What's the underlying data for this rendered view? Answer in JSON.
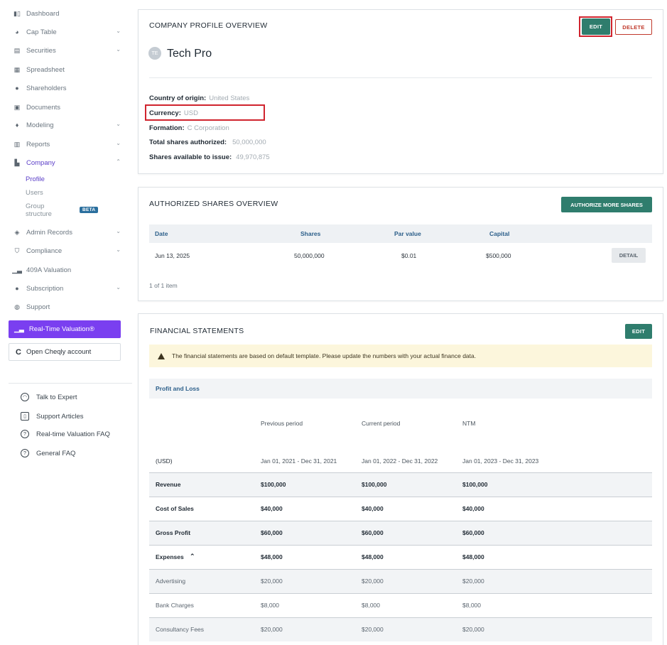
{
  "sidebar": {
    "items": [
      {
        "label": "Dashboard",
        "icon": "dashboard-icon"
      },
      {
        "label": "Cap Table",
        "icon": "pie-chart-icon"
      },
      {
        "label": "Securities",
        "icon": "clipboard-icon"
      },
      {
        "label": "Spreadsheet",
        "icon": "grid-icon"
      },
      {
        "label": "Shareholders",
        "icon": "person-icon"
      },
      {
        "label": "Documents",
        "icon": "document-icon"
      },
      {
        "label": "Modeling",
        "icon": "bulb-icon"
      },
      {
        "label": "Reports",
        "icon": "report-icon"
      },
      {
        "label": "Company",
        "icon": "building-icon"
      },
      {
        "label": "Admin Records",
        "icon": "records-icon"
      },
      {
        "label": "Compliance",
        "icon": "shield-icon"
      },
      {
        "label": "409A Valuation",
        "icon": "bar-chart-icon"
      },
      {
        "label": "Subscription",
        "icon": "dollar-icon"
      },
      {
        "label": "Support",
        "icon": "support-icon"
      }
    ],
    "company_sub": {
      "profile": "Profile",
      "users": "Users",
      "group_line1": "Group",
      "group_line2": "structure",
      "beta": "BETA"
    },
    "rtv_button": "Real-Time Valuation®",
    "cheqly_button": "Open Cheqly account",
    "help": [
      "Talk to Expert",
      "Support Articles",
      "Real-time Valuation FAQ",
      "General FAQ"
    ]
  },
  "profile_card": {
    "title": "COMPANY PROFILE OVERVIEW",
    "edit": "EDIT",
    "delete": "DELETE",
    "avatar_initials": "TE",
    "company_name": "Tech Pro",
    "fields": [
      {
        "key": "Country of origin:",
        "value": "United States"
      },
      {
        "key": "Currency:",
        "value": "USD"
      },
      {
        "key": "Formation:",
        "value": "C Corporation"
      },
      {
        "key": "Total shares authorized:",
        "value": "50,000,000"
      },
      {
        "key": "Shares available to issue:",
        "value": "49,970,875"
      }
    ]
  },
  "shares_card": {
    "title": "AUTHORIZED SHARES OVERVIEW",
    "authorize_button": "AUTHORIZE MORE SHARES",
    "columns": [
      "Date",
      "Shares",
      "Par value",
      "Capital"
    ],
    "rows": [
      {
        "date": "Jun 13, 2025",
        "shares": "50,000,000",
        "par": "$0.01",
        "capital": "$500,000",
        "action": "DETAIL"
      }
    ],
    "pager": "1 of 1 item"
  },
  "financial_card": {
    "title": "FINANCIAL STATEMENTS",
    "edit": "EDIT",
    "warning": "The financial statements are based on default template. Please update the numbers with your actual finance data.",
    "tab": "Profit and Loss",
    "periods": [
      "Previous period",
      "Current period",
      "NTM"
    ],
    "currency_label": "(USD)",
    "ranges": [
      "Jan 01, 2021 - Dec 31, 2021",
      "Jan 01, 2022 - Dec 31, 2022",
      "Jan 01, 2023 - Dec 31, 2023"
    ],
    "rows": [
      {
        "label": "Revenue",
        "v": [
          "$100,000",
          "$100,000",
          "$100,000"
        ]
      },
      {
        "label": "Cost of Sales",
        "v": [
          "$40,000",
          "$40,000",
          "$40,000"
        ]
      },
      {
        "label": "Gross Profit",
        "v": [
          "$60,000",
          "$60,000",
          "$60,000"
        ]
      },
      {
        "label": "Expenses",
        "v": [
          "$48,000",
          "$48,000",
          "$48,000"
        ]
      },
      {
        "label": "Advertising",
        "v": [
          "$20,000",
          "$20,000",
          "$20,000"
        ]
      },
      {
        "label": "Bank Charges",
        "v": [
          "$8,000",
          "$8,000",
          "$8,000"
        ]
      },
      {
        "label": "Consultancy Fees",
        "v": [
          "$20,000",
          "$20,000",
          "$20,000"
        ]
      }
    ]
  },
  "colors": {
    "accent": "#2f7d6d",
    "brand_purple": "#7a3ff0",
    "highlight_red": "#d0242e"
  }
}
